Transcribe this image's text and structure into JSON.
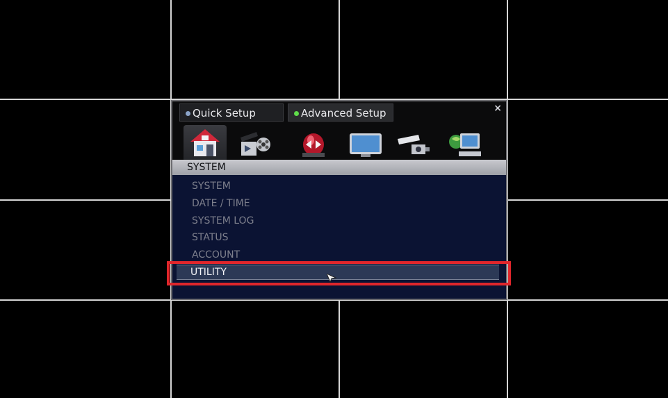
{
  "tabs": {
    "quick_setup": "Quick Setup",
    "advanced_setup": "Advanced Setup"
  },
  "close_label": "×",
  "category_icons": [
    "home-icon",
    "film-reel-icon",
    "alarm-siren-icon",
    "monitor-icon",
    "cctv-camera-icon",
    "network-globe-icon"
  ],
  "section_title": "SYSTEM",
  "menu": {
    "items": [
      "SYSTEM",
      "DATE / TIME",
      "SYSTEM LOG",
      "STATUS",
      "ACCOUNT",
      "UTILITY"
    ],
    "selected": "UTILITY"
  },
  "colors": {
    "quick_dot": "#8aa3c8",
    "advanced_dot": "#5fdc4a",
    "highlight": "#e0262b"
  }
}
